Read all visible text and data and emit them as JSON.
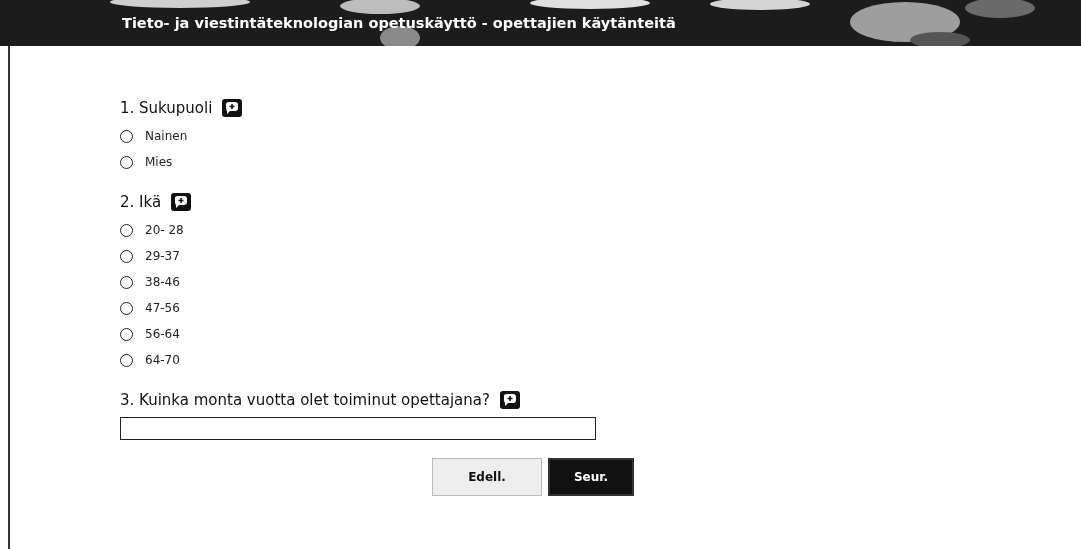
{
  "header": {
    "title": "Tieto- ja viestintäteknologian opetuskäyttö - opettajien käytänteitä"
  },
  "questions": [
    {
      "kind": "radio",
      "label": "1. Sukupuoli",
      "options": [
        {
          "label": "Nainen",
          "selected": false
        },
        {
          "label": "Mies",
          "selected": false
        }
      ]
    },
    {
      "kind": "radio",
      "label": "2. Ikä",
      "options": [
        {
          "label": "20- 28",
          "selected": false
        },
        {
          "label": "29-37",
          "selected": false
        },
        {
          "label": "38-46",
          "selected": false
        },
        {
          "label": "47-56",
          "selected": false
        },
        {
          "label": "56-64",
          "selected": false
        },
        {
          "label": "64-70",
          "selected": false
        }
      ]
    },
    {
      "kind": "text",
      "label": "3. Kuinka monta vuotta olet toiminut opettajana?"
    }
  ],
  "buttons": [
    {
      "label": "Edell.",
      "kind": "secondary"
    },
    {
      "label": "Seur.",
      "kind": "primary"
    }
  ]
}
